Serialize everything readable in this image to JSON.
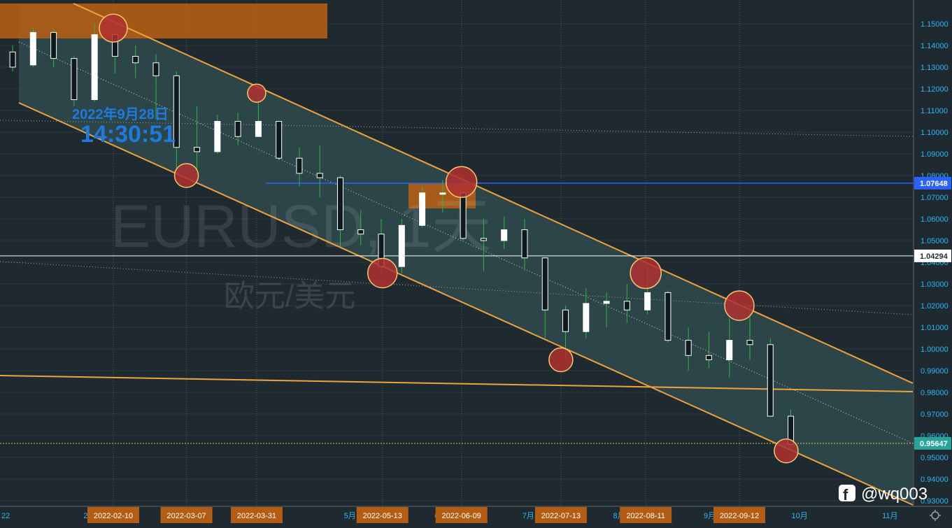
{
  "chart_data": {
    "type": "candlestick",
    "watermark": "EURUSD, 1天",
    "watermark_sub": "欧元/美元",
    "clock": {
      "date": "2022年9月28日",
      "time": "14:30:51"
    },
    "price_axis": {
      "min": 0.93,
      "max": 1.15,
      "ticks": [
        "1.15000",
        "1.14000",
        "1.13000",
        "1.12000",
        "1.11000",
        "1.10000",
        "1.09000",
        "1.08000",
        "1.07000",
        "1.06000",
        "1.05000",
        "1.04000",
        "1.03000",
        "1.02000",
        "1.01000",
        "1.00000",
        "0.99000",
        "0.98000",
        "0.97000",
        "0.96000",
        "0.95000",
        "0.94000",
        "0.93000"
      ]
    },
    "markers": [
      {
        "label": "1.07648",
        "value": 1.07648,
        "color": "#2962ff"
      },
      {
        "label": "1.04294",
        "value": 1.04294,
        "color": "#ffffff"
      },
      {
        "label": "0.95647",
        "value": 0.95647,
        "color": "#26a69a"
      }
    ],
    "time_axis": {
      "start_label": "22",
      "month_labels": [
        "2月",
        "5月",
        "6月",
        "7月",
        "8月",
        "9月",
        "10月",
        "11月"
      ],
      "date_labels": [
        "2022-02-10",
        "2022-03-07",
        "2022-03-31",
        "2022-05-13",
        "2022-06-09",
        "2022-07-13",
        "2022-08-11",
        "2022-09-12"
      ]
    },
    "series": [
      {
        "date": "2022-01-03",
        "open": 1.137,
        "high": 1.14,
        "low": 1.128,
        "close": 1.13
      },
      {
        "date": "2022-01-10",
        "open": 1.131,
        "high": 1.148,
        "low": 1.13,
        "close": 1.146
      },
      {
        "date": "2022-01-17",
        "open": 1.146,
        "high": 1.148,
        "low": 1.13,
        "close": 1.134
      },
      {
        "date": "2022-01-24",
        "open": 1.134,
        "high": 1.135,
        "low": 1.112,
        "close": 1.115
      },
      {
        "date": "2022-01-31",
        "open": 1.115,
        "high": 1.15,
        "low": 1.114,
        "close": 1.145
      },
      {
        "date": "2022-02-07",
        "open": 1.145,
        "high": 1.15,
        "low": 1.127,
        "close": 1.135
      },
      {
        "date": "2022-02-14",
        "open": 1.135,
        "high": 1.14,
        "low": 1.125,
        "close": 1.132
      },
      {
        "date": "2022-02-21",
        "open": 1.132,
        "high": 1.136,
        "low": 1.106,
        "close": 1.126
      },
      {
        "date": "2022-02-28",
        "open": 1.126,
        "high": 1.128,
        "low": 1.082,
        "close": 1.093
      },
      {
        "date": "2022-03-07",
        "open": 1.093,
        "high": 1.112,
        "low": 1.08,
        "close": 1.091
      },
      {
        "date": "2022-03-14",
        "open": 1.091,
        "high": 1.108,
        "low": 1.09,
        "close": 1.105
      },
      {
        "date": "2022-03-21",
        "open": 1.105,
        "high": 1.109,
        "low": 1.094,
        "close": 1.098
      },
      {
        "date": "2022-03-28",
        "open": 1.098,
        "high": 1.118,
        "low": 1.098,
        "close": 1.105
      },
      {
        "date": "2022-04-04",
        "open": 1.105,
        "high": 1.105,
        "low": 1.087,
        "close": 1.088
      },
      {
        "date": "2022-04-11",
        "open": 1.088,
        "high": 1.093,
        "low": 1.075,
        "close": 1.081
      },
      {
        "date": "2022-04-18",
        "open": 1.081,
        "high": 1.094,
        "low": 1.07,
        "close": 1.079
      },
      {
        "date": "2022-04-25",
        "open": 1.079,
        "high": 1.08,
        "low": 1.047,
        "close": 1.055
      },
      {
        "date": "2022-05-02",
        "open": 1.055,
        "high": 1.064,
        "low": 1.048,
        "close": 1.053
      },
      {
        "date": "2022-05-09",
        "open": 1.053,
        "high": 1.06,
        "low": 1.035,
        "close": 1.038
      },
      {
        "date": "2022-05-16",
        "open": 1.038,
        "high": 1.06,
        "low": 1.035,
        "close": 1.057
      },
      {
        "date": "2022-05-23",
        "open": 1.057,
        "high": 1.075,
        "low": 1.056,
        "close": 1.072
      },
      {
        "date": "2022-05-30",
        "open": 1.072,
        "high": 1.078,
        "low": 1.063,
        "close": 1.072
      },
      {
        "date": "2022-06-06",
        "open": 1.072,
        "high": 1.077,
        "low": 1.05,
        "close": 1.051
      },
      {
        "date": "2022-06-13",
        "open": 1.051,
        "high": 1.06,
        "low": 1.036,
        "close": 1.05
      },
      {
        "date": "2022-06-20",
        "open": 1.05,
        "high": 1.061,
        "low": 1.046,
        "close": 1.055
      },
      {
        "date": "2022-06-27",
        "open": 1.055,
        "high": 1.06,
        "low": 1.036,
        "close": 1.042
      },
      {
        "date": "2022-07-04",
        "open": 1.042,
        "high": 1.043,
        "low": 1.005,
        "close": 1.018
      },
      {
        "date": "2022-07-11",
        "open": 1.018,
        "high": 1.02,
        "low": 0.995,
        "close": 1.008
      },
      {
        "date": "2022-07-18",
        "open": 1.008,
        "high": 1.028,
        "low": 1.005,
        "close": 1.021
      },
      {
        "date": "2022-07-25",
        "open": 1.021,
        "high": 1.026,
        "low": 1.01,
        "close": 1.022
      },
      {
        "date": "2022-08-01",
        "open": 1.022,
        "high": 1.03,
        "low": 1.012,
        "close": 1.018
      },
      {
        "date": "2022-08-08",
        "open": 1.018,
        "high": 1.037,
        "low": 1.016,
        "close": 1.026
      },
      {
        "date": "2022-08-15",
        "open": 1.026,
        "high": 1.027,
        "low": 1.003,
        "close": 1.004
      },
      {
        "date": "2022-08-22",
        "open": 1.004,
        "high": 1.01,
        "low": 0.99,
        "close": 0.997
      },
      {
        "date": "2022-08-29",
        "open": 0.997,
        "high": 1.008,
        "low": 0.991,
        "close": 0.995
      },
      {
        "date": "2022-09-05",
        "open": 0.995,
        "high": 1.014,
        "low": 0.987,
        "close": 1.004
      },
      {
        "date": "2022-09-12",
        "open": 1.004,
        "high": 1.02,
        "low": 0.995,
        "close": 1.002
      },
      {
        "date": "2022-09-19",
        "open": 1.002,
        "high": 1.005,
        "low": 0.969,
        "close": 0.969
      },
      {
        "date": "2022-09-26",
        "open": 0.969,
        "high": 0.972,
        "low": 0.953,
        "close": 0.956
      }
    ],
    "highlight_points": [
      {
        "date": "2022-02-10",
        "value": 1.148
      },
      {
        "date": "2022-03-07",
        "value": 1.08
      },
      {
        "date": "2022-03-31",
        "value": 1.118
      },
      {
        "date": "2022-05-13",
        "value": 1.035
      },
      {
        "date": "2022-06-09",
        "value": 1.077
      },
      {
        "date": "2022-07-13",
        "value": 0.995
      },
      {
        "date": "2022-08-11",
        "value": 1.035
      },
      {
        "date": "2022-09-12",
        "value": 1.02
      },
      {
        "date": "2022-09-28",
        "value": 0.953
      }
    ],
    "grid": true
  },
  "social": {
    "handle": "@wq003"
  },
  "colors": {
    "background": "#1e2a30",
    "channel_fill": "#2e4a4e",
    "channel_line": "#f0a23c",
    "candle_up": "#ffffff",
    "candle_down": "#ffffff",
    "wick": "#2db83d",
    "circle_fill": "#b03030",
    "circle_stroke": "#f5c66e",
    "date_tag": "#b35d14",
    "clock_text": "#1f7ae0"
  }
}
